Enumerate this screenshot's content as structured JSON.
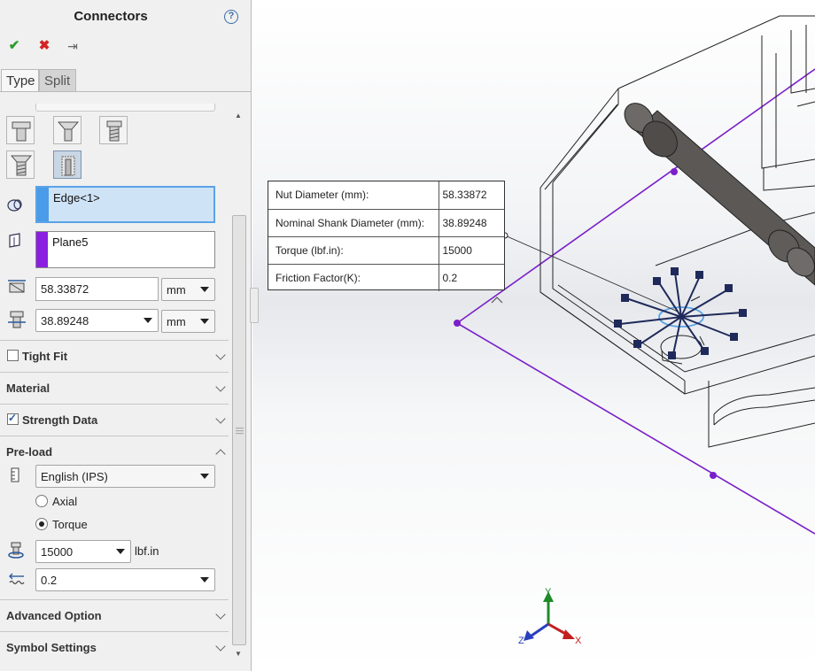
{
  "panel": {
    "title": "Connectors",
    "help_glyph": "?",
    "toolbar": {
      "ok": "✔",
      "cancel": "✖",
      "pin": "⇥"
    },
    "tabs": [
      {
        "label": "Type"
      },
      {
        "label": "Split"
      }
    ],
    "selections": {
      "edge": "Edge<1>",
      "plane": "Plane5",
      "edge_color": "#4a9be8",
      "plane_color": "#8a1fe0"
    },
    "nut_diameter": {
      "value": "58.33872",
      "unit": "mm"
    },
    "shank_diameter": {
      "value": "38.89248",
      "unit": "mm"
    },
    "sections": {
      "tight_fit": "Tight Fit",
      "material": "Material",
      "strength_data": "Strength Data",
      "preload": "Pre-load",
      "advanced": "Advanced Option",
      "symbol": "Symbol Settings"
    },
    "preload": {
      "units": "English (IPS)",
      "axial": "Axial",
      "torque": "Torque",
      "torque_value": "15000",
      "torque_unit": "lbf.in",
      "friction_value": "0.2"
    }
  },
  "callout": {
    "rows": [
      {
        "label": "Nut Diameter (mm):",
        "value": "58.33872"
      },
      {
        "label": "Nominal Shank Diameter (mm):",
        "value": "38.89248"
      },
      {
        "label": "Torque (lbf.in):",
        "value": "15000"
      },
      {
        "label": "Friction Factor(K):",
        "value": "0.2"
      }
    ]
  },
  "triad": {
    "x": "X",
    "y": "Y",
    "z": "Z"
  },
  "colors": {
    "plane_line": "#7a1fc9",
    "bolt_body": "#5b5855",
    "connector_symbol": "#1f2a5a"
  }
}
